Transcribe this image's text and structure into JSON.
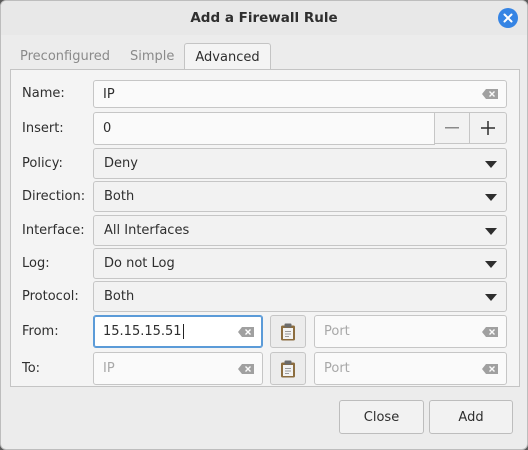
{
  "dialog": {
    "title": "Add a Firewall Rule"
  },
  "tabs": [
    {
      "label": "Preconfigured",
      "active": false
    },
    {
      "label": "Simple",
      "active": false
    },
    {
      "label": "Advanced",
      "active": true
    }
  ],
  "form": {
    "name": {
      "label": "Name:",
      "value": "IP"
    },
    "insert": {
      "label": "Insert:",
      "value": "0"
    },
    "policy": {
      "label": "Policy:",
      "value": "Deny"
    },
    "direction": {
      "label": "Direction:",
      "value": "Both"
    },
    "interface": {
      "label": "Interface:",
      "value": "All Interfaces"
    },
    "log": {
      "label": "Log:",
      "value": "Do not Log"
    },
    "protocol": {
      "label": "Protocol:",
      "value": "Both"
    },
    "from": {
      "label": "From:",
      "ip_value": "15.15.15.51",
      "ip_placeholder": "IP",
      "port_placeholder": "Port"
    },
    "to": {
      "label": "To:",
      "ip_value": "",
      "ip_placeholder": "IP",
      "port_placeholder": "Port"
    }
  },
  "buttons": {
    "close": "Close",
    "add": "Add"
  },
  "colors": {
    "accent": "#3584e4",
    "focus_border": "#5b9bd8"
  },
  "icons": [
    "close-icon",
    "clear-icon",
    "minus-icon",
    "plus-icon",
    "paste-icon",
    "chevron-down-icon"
  ]
}
